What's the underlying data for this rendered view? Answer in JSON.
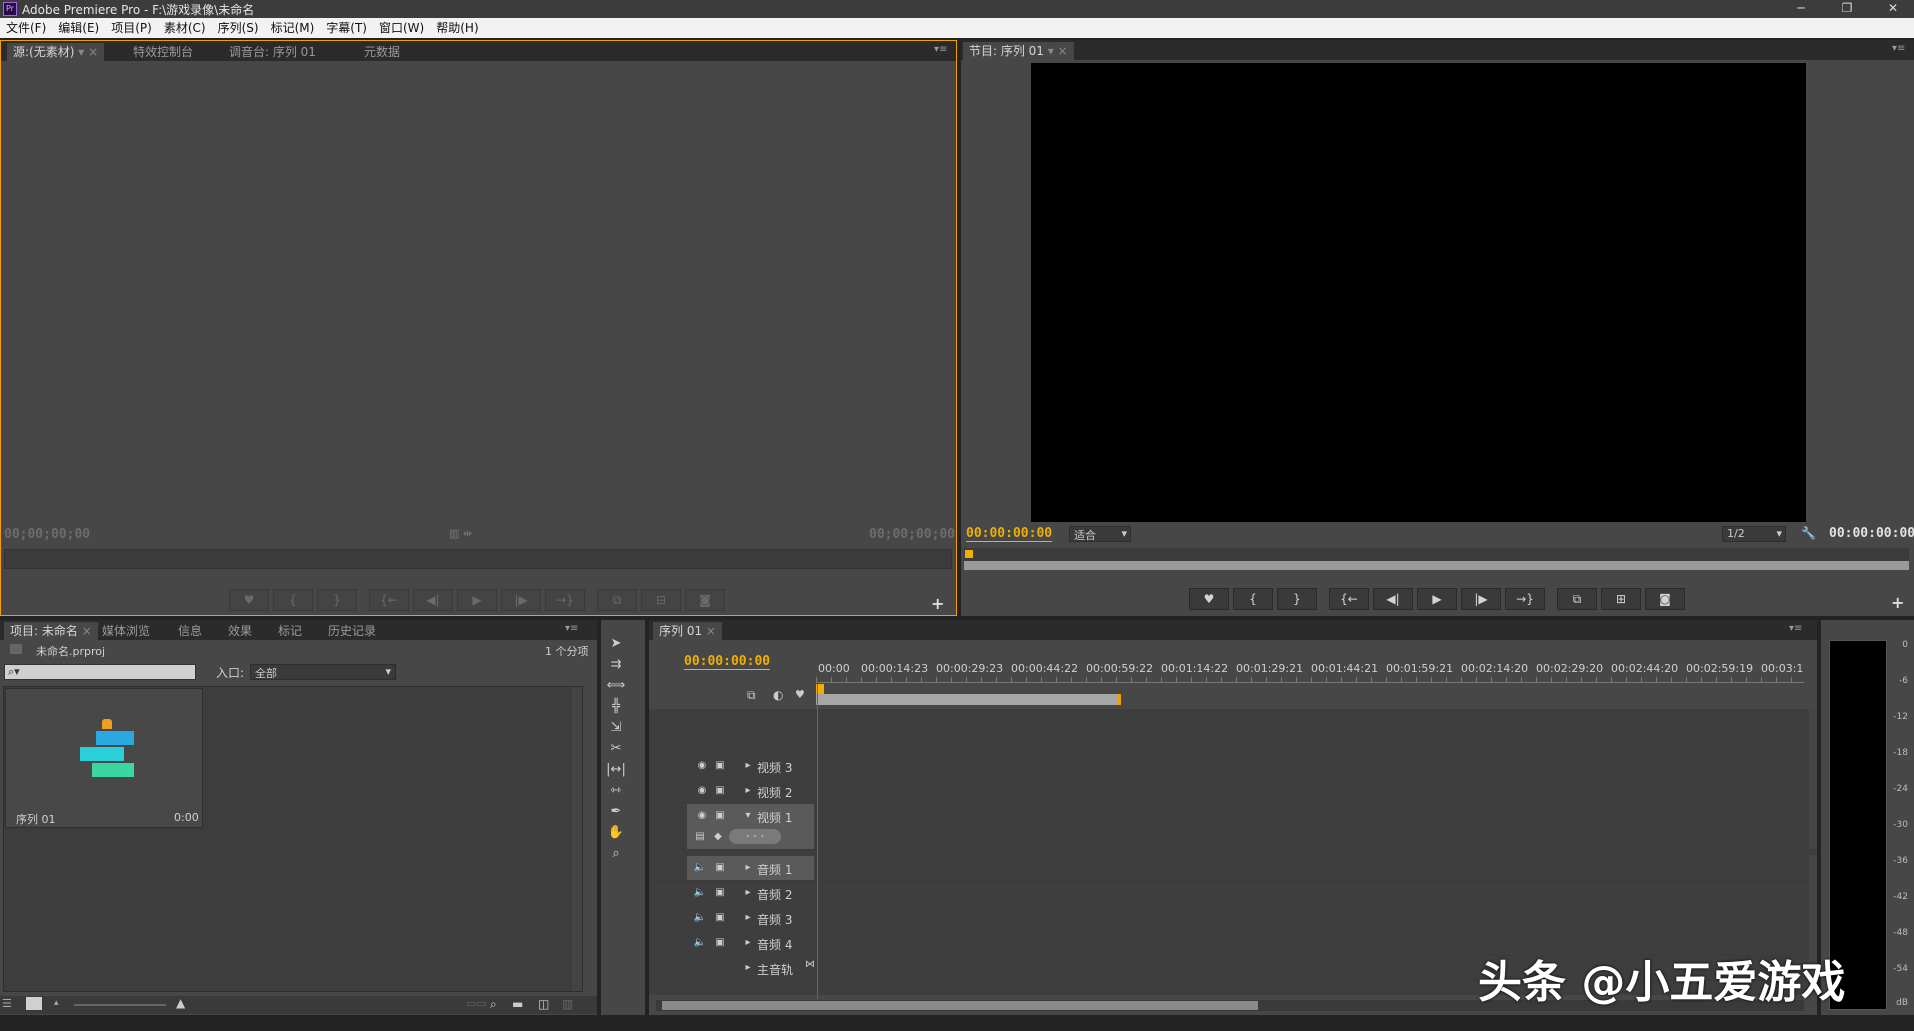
{
  "window": {
    "title": "Adobe Premiere Pro - F:\\游戏录像\\未命名",
    "app_icon": "Pr",
    "controls": [
      "─",
      "❐",
      "✕"
    ]
  },
  "menu": [
    "文件(F)",
    "编辑(E)",
    "项目(P)",
    "素材(C)",
    "序列(S)",
    "标记(M)",
    "字幕(T)",
    "窗口(W)",
    "帮助(H)"
  ],
  "source_panel": {
    "tabs": [
      "源:(无素材)",
      "特效控制台",
      "调音台: 序列 01",
      "元数据"
    ],
    "timecode_left": "00;00;00;00",
    "timecode_right": "00;00;00;00"
  },
  "program_panel": {
    "tab": "节目: 序列 01",
    "timecode_left": "00:00:00:00",
    "fit_label": "适合",
    "resolution": "1/2",
    "timecode_right": "00:00:00:00"
  },
  "project_panel": {
    "tabs": [
      "项目: 未命名",
      "媒体浏览",
      "信息",
      "效果",
      "标记",
      "历史记录"
    ],
    "filename": "未命名.prproj",
    "item_count": "1 个分项",
    "in_label": "入口:",
    "in_value": "全部",
    "thumb_name": "序列 01",
    "thumb_duration": "0:00"
  },
  "timeline": {
    "tab": "序列 01",
    "timecode": "00:00:00:00",
    "ruler": [
      "00:00",
      "00:00:14:23",
      "00:00:29:23",
      "00:00:44:22",
      "00:00:59:22",
      "00:01:14:22",
      "00:01:29:21",
      "00:01:44:21",
      "00:01:59:21",
      "00:02:14:20",
      "00:02:29:20",
      "00:02:44:20",
      "00:02:59:19",
      "00:03:1"
    ],
    "video_tracks": [
      "视频 3",
      "视频 2",
      "视频 1"
    ],
    "audio_tracks": [
      "音频 1",
      "音频 2",
      "音频 3",
      "音频 4"
    ],
    "master_track": "主音轨",
    "key_pill": "• • •"
  },
  "audio_meter": {
    "scale": [
      "0",
      "-6",
      "-12",
      "-18",
      "-24",
      "-30",
      "-36",
      "-42",
      "-48",
      "-54",
      "dB"
    ]
  },
  "watermark": "头条 @小五爱游戏",
  "colors": {
    "accent_timecode": "#f0b000",
    "playhead": "#e03030",
    "panel_bg": "#474747",
    "panel_focus_border": "#f0a000"
  }
}
